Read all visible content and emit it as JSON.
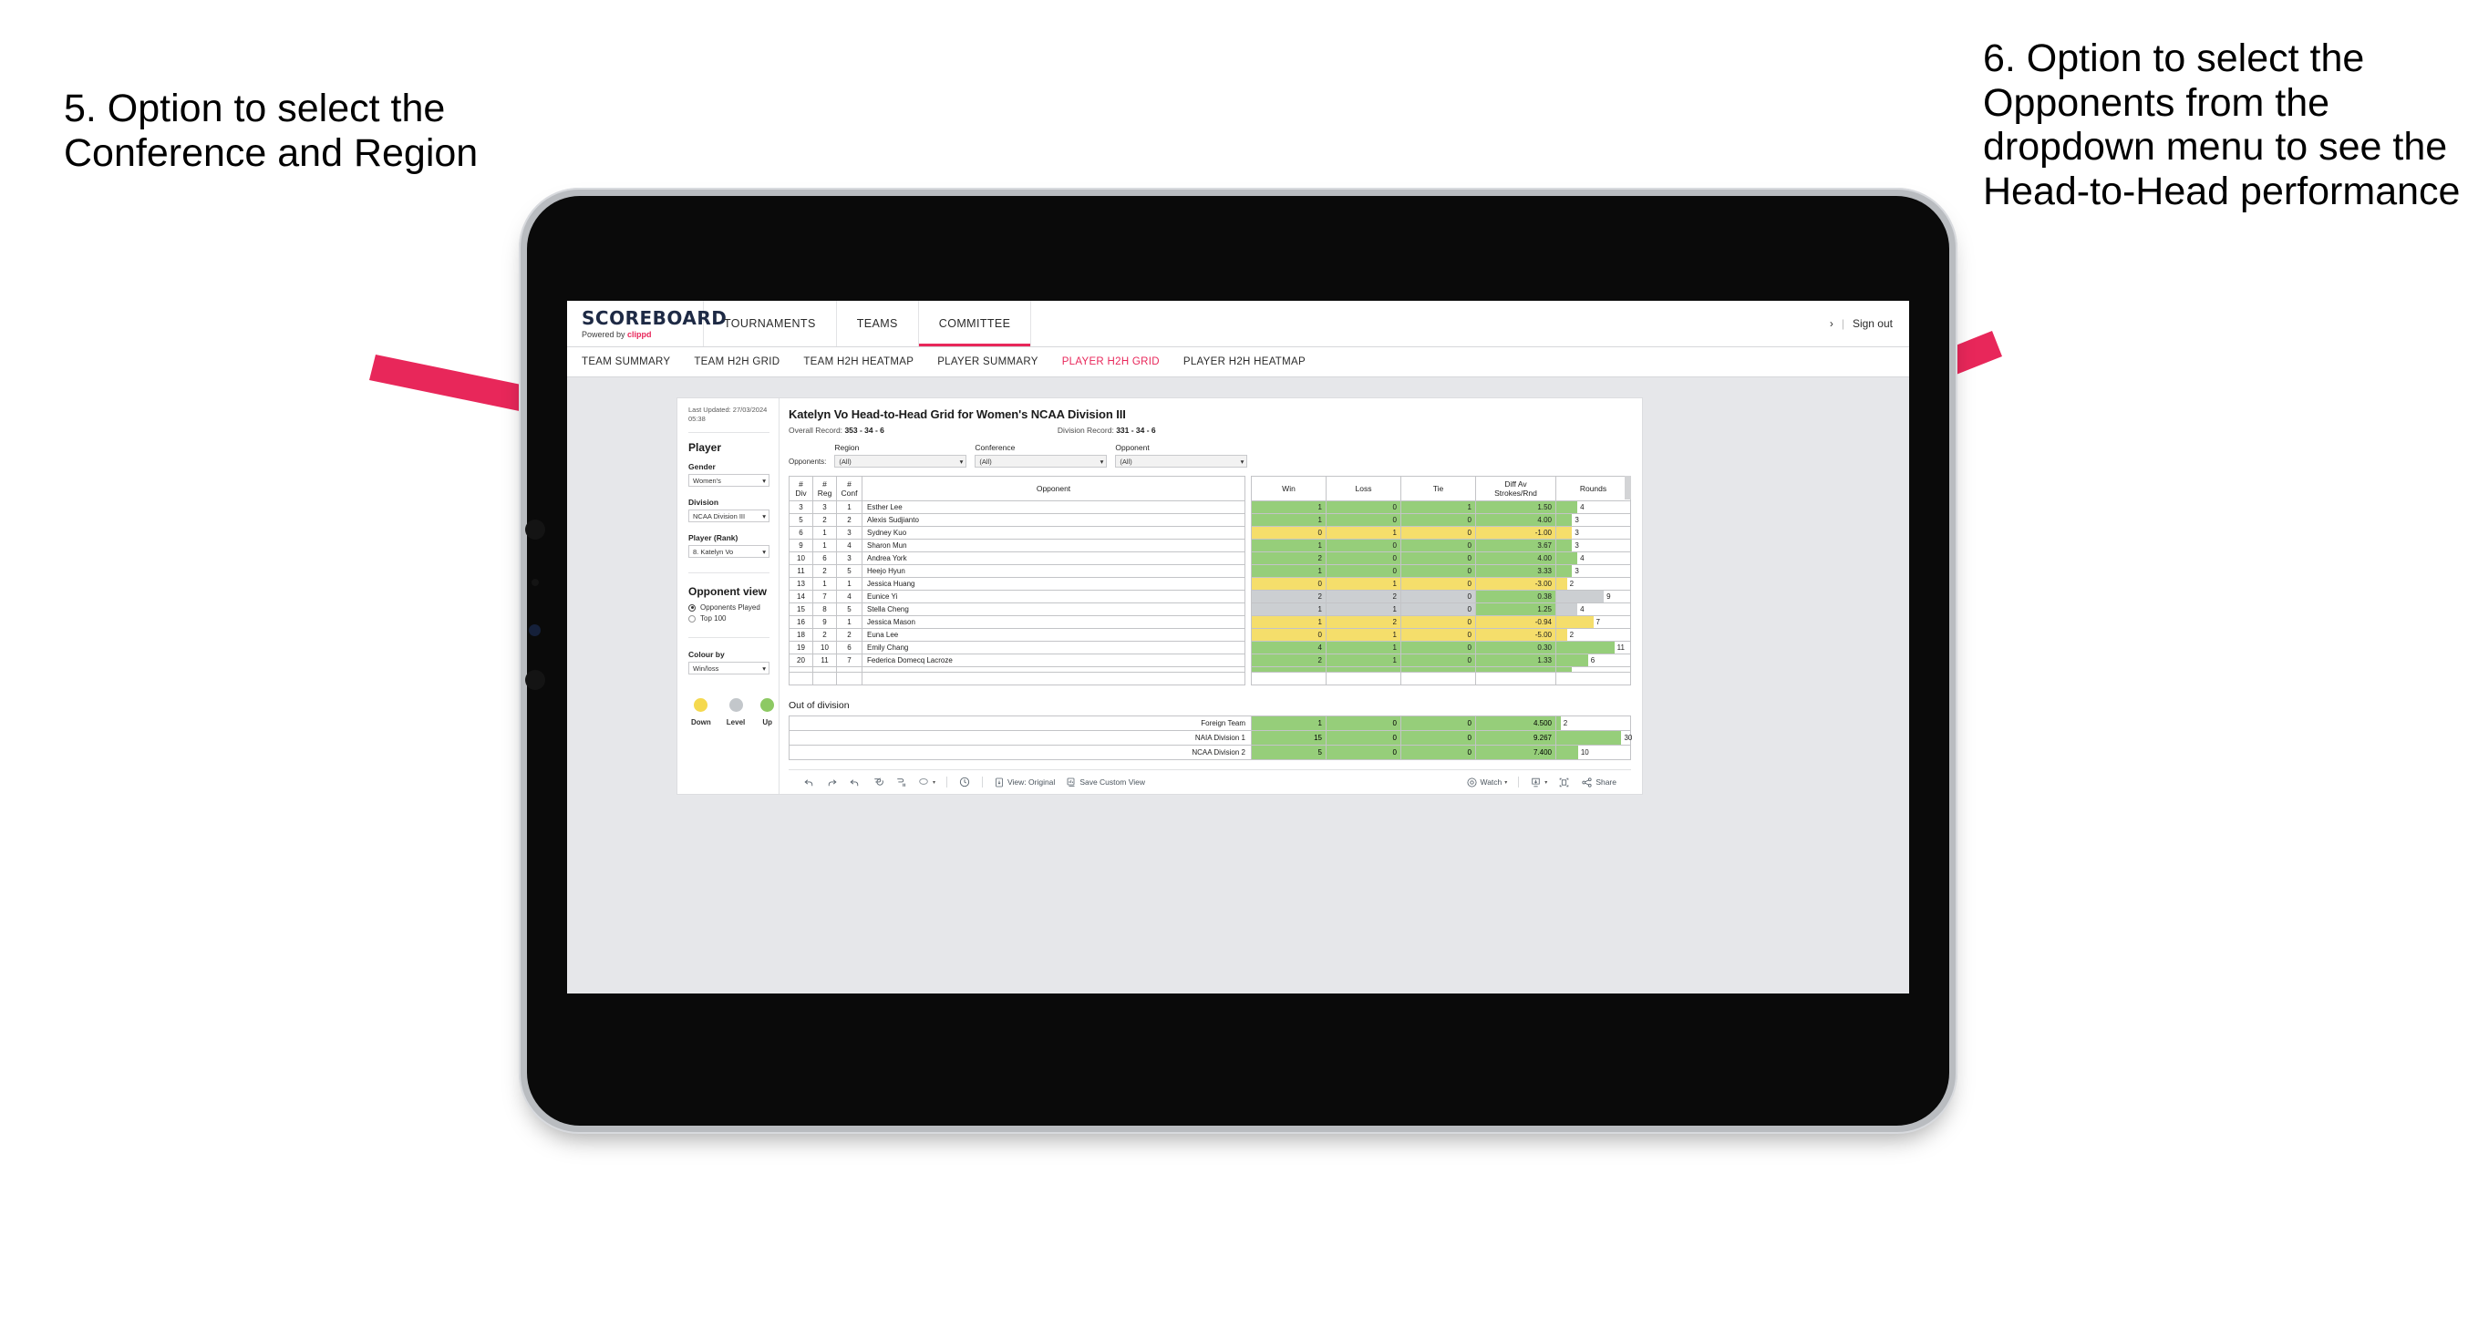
{
  "annotations": {
    "left": "5. Option to select the Conference and Region",
    "right": "6. Option to select the Opponents from the dropdown menu to see the Head-to-Head performance",
    "arrow_color": "#E8275A"
  },
  "topnav": {
    "logo_word": "SCOREBOARD",
    "logo_powered": "Powered by",
    "logo_brand": "clippd",
    "items": [
      {
        "label": "TOURNAMENTS",
        "active": false
      },
      {
        "label": "TEAMS",
        "active": false
      },
      {
        "label": "COMMITTEE",
        "active": true
      }
    ],
    "chevron": "›",
    "separator": "|",
    "signout": "Sign out"
  },
  "subnav": {
    "items": [
      {
        "label": "TEAM SUMMARY",
        "active": false
      },
      {
        "label": "TEAM H2H GRID",
        "active": false
      },
      {
        "label": "TEAM H2H HEATMAP",
        "active": false
      },
      {
        "label": "PLAYER SUMMARY",
        "active": false
      },
      {
        "label": "PLAYER H2H GRID",
        "active": true
      },
      {
        "label": "PLAYER H2H HEATMAP",
        "active": false
      }
    ],
    "active_color": "#E8275A"
  },
  "sidebar": {
    "last_updated": "Last Updated: 27/03/2024 05:38",
    "player_heading": "Player",
    "gender_label": "Gender",
    "gender_value": "Women's",
    "division_label": "Division",
    "division_value": "NCAA Division III",
    "player_rank_label": "Player (Rank)",
    "player_rank_value": "8. Katelyn Vo",
    "opponent_view_heading": "Opponent view",
    "radios": [
      {
        "label": "Opponents Played",
        "selected": true
      },
      {
        "label": "Top 100",
        "selected": false
      }
    ],
    "colour_by_label": "Colour by",
    "colour_by_value": "Win/loss",
    "legend": [
      {
        "label": "Down",
        "color": "#F5D94F"
      },
      {
        "label": "Level",
        "color": "#C3C7CB"
      },
      {
        "label": "Up",
        "color": "#8DC963"
      }
    ]
  },
  "viz": {
    "title": "Katelyn Vo Head-to-Head Grid for Women's NCAA Division III",
    "overall_record_label": "Overall Record:",
    "overall_record_value": "353 - 34 - 6",
    "division_record_label": "Division Record:",
    "division_record_value": "331 - 34 - 6",
    "opponents_label": "Opponents:",
    "filters": [
      {
        "label": "Region",
        "value": "(All)"
      },
      {
        "label": "Conference",
        "value": "(All)"
      },
      {
        "label": "Opponent",
        "value": "(All)"
      }
    ],
    "caret": "▾"
  },
  "table": {
    "headers": [
      "# Div",
      "# Reg",
      "# Conf",
      "Opponent",
      "Win",
      "Loss",
      "Tie",
      "Diff Av Strokes/Rnd",
      "Rounds"
    ],
    "header_lines": [
      [
        "#",
        "Div"
      ],
      [
        "#",
        "Reg"
      ],
      [
        "#",
        "Conf"
      ],
      [
        "Opponent"
      ],
      [
        "Win"
      ],
      [
        "Loss"
      ],
      [
        "Tie"
      ],
      [
        "Diff Av",
        "Strokes/Rnd"
      ],
      [
        "Rounds"
      ]
    ],
    "colors": {
      "green": "#96CE7A",
      "yellow": "#F5DE6B",
      "grey": "#CCCFD2"
    },
    "rounds_max": 14,
    "rows": [
      {
        "div": "3",
        "reg": "3",
        "conf": "1",
        "opponent": "Esther Lee",
        "win": "1",
        "loss": "0",
        "tie": "1",
        "diff": "1.50",
        "rounds": "4",
        "color": "green"
      },
      {
        "div": "5",
        "reg": "2",
        "conf": "2",
        "opponent": "Alexis Sudjianto",
        "win": "1",
        "loss": "0",
        "tie": "0",
        "diff": "4.00",
        "rounds": "3",
        "color": "green"
      },
      {
        "div": "6",
        "reg": "1",
        "conf": "3",
        "opponent": "Sydney Kuo",
        "win": "0",
        "loss": "1",
        "tie": "0",
        "diff": "-1.00",
        "rounds": "3",
        "color": "yellow"
      },
      {
        "div": "9",
        "reg": "1",
        "conf": "4",
        "opponent": "Sharon Mun",
        "win": "1",
        "loss": "0",
        "tie": "0",
        "diff": "3.67",
        "rounds": "3",
        "color": "green"
      },
      {
        "div": "10",
        "reg": "6",
        "conf": "3",
        "opponent": "Andrea York",
        "win": "2",
        "loss": "0",
        "tie": "0",
        "diff": "4.00",
        "rounds": "4",
        "color": "green"
      },
      {
        "div": "11",
        "reg": "2",
        "conf": "5",
        "opponent": "Heejo Hyun",
        "win": "1",
        "loss": "0",
        "tie": "0",
        "diff": "3.33",
        "rounds": "3",
        "color": "green"
      },
      {
        "div": "13",
        "reg": "1",
        "conf": "1",
        "opponent": "Jessica Huang",
        "win": "0",
        "loss": "1",
        "tie": "0",
        "diff": "-3.00",
        "rounds": "2",
        "color": "yellow"
      },
      {
        "div": "14",
        "reg": "7",
        "conf": "4",
        "opponent": "Eunice Yi",
        "win": "2",
        "loss": "2",
        "tie": "0",
        "diff": "0.38",
        "rounds": "9",
        "color": "grey",
        "diff_color": "green"
      },
      {
        "div": "15",
        "reg": "8",
        "conf": "5",
        "opponent": "Stella Cheng",
        "win": "1",
        "loss": "1",
        "tie": "0",
        "diff": "1.25",
        "rounds": "4",
        "color": "grey",
        "diff_color": "green"
      },
      {
        "div": "16",
        "reg": "9",
        "conf": "1",
        "opponent": "Jessica Mason",
        "win": "1",
        "loss": "2",
        "tie": "0",
        "diff": "-0.94",
        "rounds": "7",
        "color": "yellow"
      },
      {
        "div": "18",
        "reg": "2",
        "conf": "2",
        "opponent": "Euna Lee",
        "win": "0",
        "loss": "1",
        "tie": "0",
        "diff": "-5.00",
        "rounds": "2",
        "color": "yellow"
      },
      {
        "div": "19",
        "reg": "10",
        "conf": "6",
        "opponent": "Emily Chang",
        "win": "4",
        "loss": "1",
        "tie": "0",
        "diff": "0.30",
        "rounds": "11",
        "color": "green"
      },
      {
        "div": "20",
        "reg": "11",
        "conf": "7",
        "opponent": "Federica Domecq Lacroze",
        "win": "2",
        "loss": "1",
        "tie": "0",
        "diff": "1.33",
        "rounds": "6",
        "color": "green"
      }
    ]
  },
  "out_of_division": {
    "heading": "Out of division",
    "rounds_max": 34,
    "rows": [
      {
        "name": "Foreign Team",
        "win": "1",
        "loss": "0",
        "tie": "0",
        "diff": "4.500",
        "rounds": "2",
        "color": "green"
      },
      {
        "name": "NAIA Division 1",
        "win": "15",
        "loss": "0",
        "tie": "0",
        "diff": "9.267",
        "rounds": "30",
        "color": "green"
      },
      {
        "name": "NCAA Division 2",
        "win": "5",
        "loss": "0",
        "tie": "0",
        "diff": "7.400",
        "rounds": "10",
        "color": "green"
      }
    ]
  },
  "toolbar": {
    "undo": "undo-icon",
    "redo": "redo-icon",
    "revert": "revert-icon",
    "refresh": "refresh-data-icon",
    "pause": "pause-updates-icon",
    "view_original_label": "View: Original",
    "save_custom_view_label": "Save Custom View",
    "watch_label": "Watch",
    "share_label": "Share"
  }
}
